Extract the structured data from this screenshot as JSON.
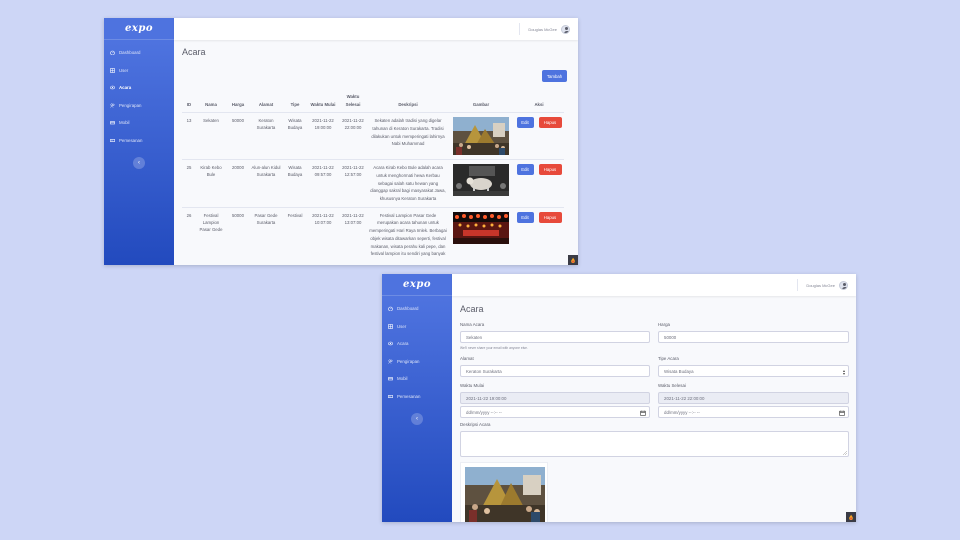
{
  "brand": "expo",
  "user_name": "Douglas McGee",
  "nav": [
    {
      "label": "Dashboard",
      "icon": "dashboard-icon"
    },
    {
      "label": "User",
      "icon": "user-icon"
    },
    {
      "label": "Acara",
      "icon": "calendar-icon"
    },
    {
      "label": "Pengirapan",
      "icon": "users-icon"
    },
    {
      "label": "Mobil",
      "icon": "car-icon"
    },
    {
      "label": "Pemesanan",
      "icon": "ticket-icon"
    }
  ],
  "list": {
    "title": "Acara",
    "add_label": "Tambah",
    "columns": [
      "ID",
      "Nama",
      "Harga",
      "Alamat",
      "Tipe",
      "Waktu Mulai",
      "Waktu Selesai",
      "Deskripsi",
      "Gambar",
      "Aksi"
    ],
    "rows": [
      {
        "id": "13",
        "nama": "Sekaten",
        "harga": "50000",
        "alamat": "Keraton Surakarta",
        "tipe": "Wisata Budaya",
        "mulai": "2021-11-22 19:00:00",
        "selesai": "2021-11-22 22:00:00",
        "deskripsi": "Sekaten adalah tradisi yang digelar tahunan di Keraton Surakarta. Tradisi dilakukan untuk memperingati lahirnya Nabi Muhammad",
        "gambar": "sekaten-crowd-photo"
      },
      {
        "id": "25",
        "nama": "Kirab Kebo Bule",
        "harga": "20000",
        "alamat": "Alun-alun Kidul Surakarta",
        "tipe": "Wisata Budaya",
        "mulai": "2021-11-22 09:57:00",
        "selesai": "2021-11-22 12:57:00",
        "deskripsi": "Acara Kirab Kebo Bule adalah acara untuk menghormati hewa Kerbau sebagai salah satu hewan yang dianggap sakral bagi masyarakat Jawa, khususnya Keraton Surakarta",
        "gambar": "kebo-bule-photo"
      },
      {
        "id": "26",
        "nama": "Festival Lampion Pasar Gede",
        "harga": "50000",
        "alamat": "Pasar Gede Surakarta",
        "tipe": "Festival",
        "mulai": "2021-11-22 10:07:00",
        "selesai": "2021-11-22 13:07:00",
        "deskripsi": "Festival Lampion Pasar Gede merupakan acara tahunan untuk memperingati Hari Raya Imlek. Berbagai objek wisata ditawarkan seperti, festival makanan, wisata perahu kali pepe, dan festival lampion itu sendiri yang banyak",
        "gambar": "lampion-festival-photo"
      }
    ],
    "edit_label": "Edit",
    "delete_label": "Hapus"
  },
  "form": {
    "title": "Acara",
    "nama_label": "Nama Acara",
    "nama_value": "Sekaten",
    "nama_help": "We'll never share your email with anyone else.",
    "harga_label": "Harga",
    "harga_value": "50000",
    "alamat_label": "Alamat",
    "alamat_value": "Keraton Surakarta",
    "tipe_label": "Tipe Acara",
    "tipe_value": "Wisata Budaya",
    "mulai_label": "Waktu Mulai",
    "mulai_value": "2021-11-22 19:00:00",
    "mulai_placeholder": "dd/mm/yyyy --:-- --",
    "selesai_label": "Waktu Selesai",
    "selesai_value": "2021-11-22 22:00:00",
    "selesai_placeholder": "dd/mm/yyyy --:-- --",
    "deskripsi_label": "Deskripsi Acara",
    "deskripsi_value": ""
  },
  "colors": {
    "primary": "#4e73df",
    "danger": "#e74a3b",
    "sidebar_top": "#4e73df",
    "sidebar_bottom": "#224abe",
    "background": "#cdd6f6"
  }
}
